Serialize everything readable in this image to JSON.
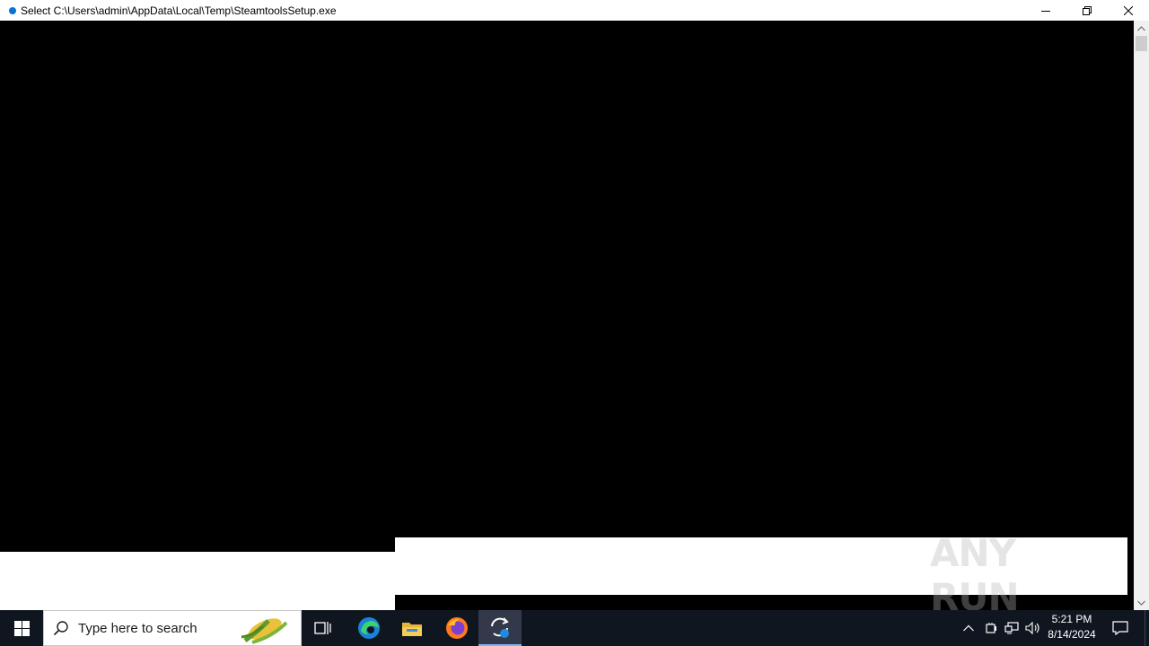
{
  "window": {
    "title": "Select C:\\Users\\admin\\AppData\\Local\\Temp\\SteamtoolsSetup.exe",
    "controls": [
      "minimize-icon",
      "restore-icon",
      "close-icon"
    ]
  },
  "watermark": {
    "text": "ANY RUN"
  },
  "taskbar": {
    "search_placeholder": "Type here to search",
    "pinned": [
      "task-view-icon",
      "edge-icon",
      "file-explorer-icon",
      "firefox-icon",
      "steamtools-icon"
    ],
    "clock": {
      "time": "5:21 PM",
      "date": "8/14/2024"
    }
  },
  "colors": {
    "taskbar_bg": "#10161f",
    "accent": "#76b9ed",
    "title_icon": "#0a6fd6"
  }
}
